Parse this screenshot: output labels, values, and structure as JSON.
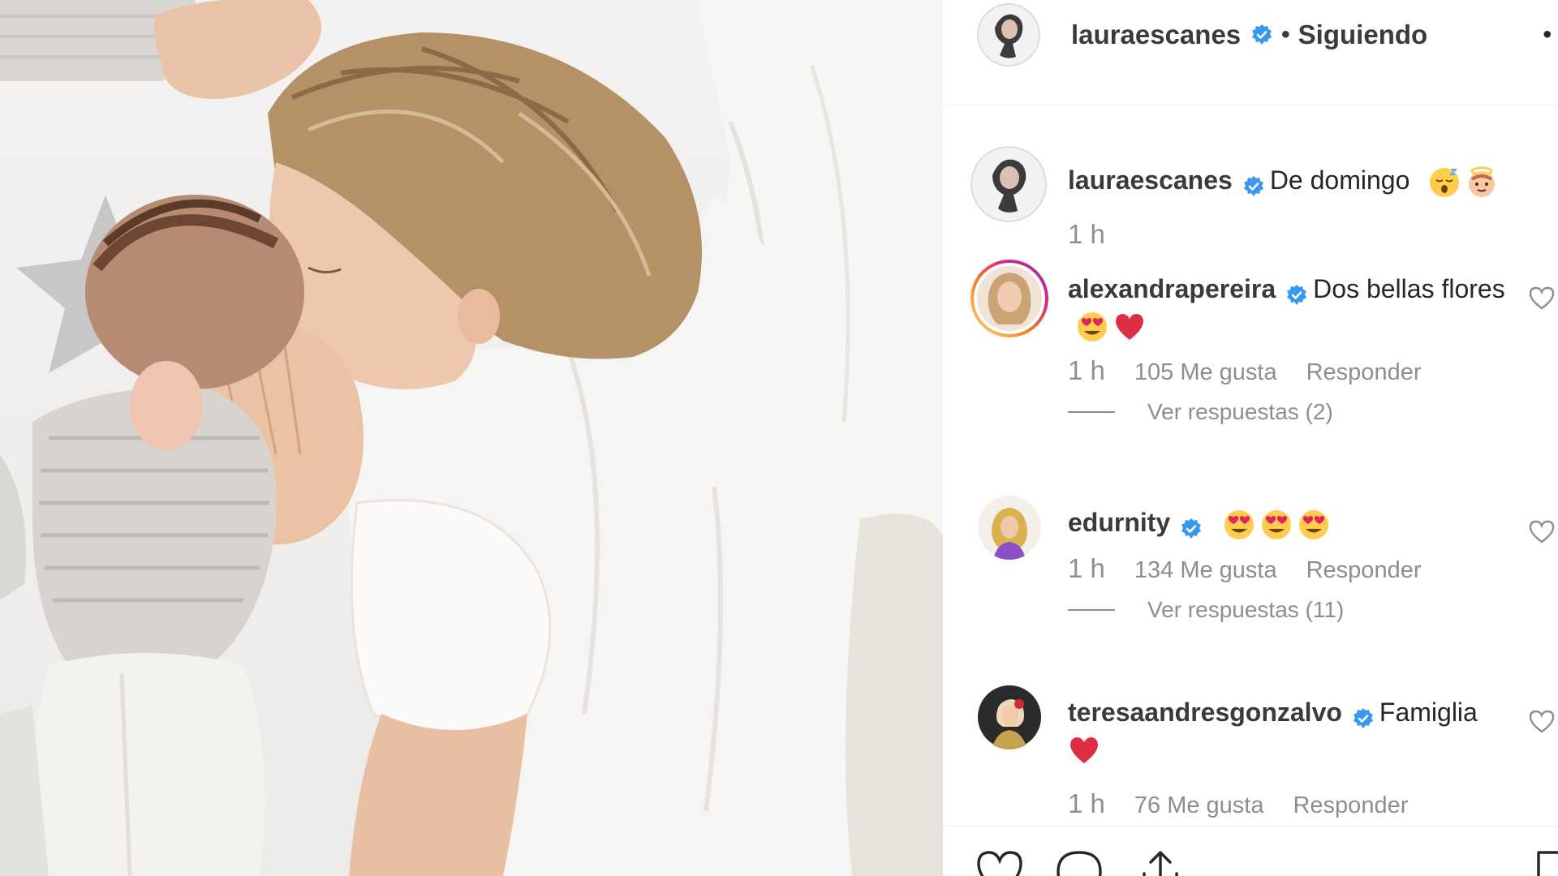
{
  "post": {
    "author": "lauraescanes",
    "follow_separator": "•",
    "follow_label": "Siguiendo",
    "more_label": "•",
    "caption": "De domingo",
    "caption_emojis": [
      "sleeping-face-emoji",
      "baby-angel-emoji"
    ],
    "caption_time": "1 h"
  },
  "comments": [
    {
      "user": "alexandrapereira",
      "text": "Dos bellas flores",
      "emojis": [
        "heart-eyes-emoji",
        "red-heart-emoji"
      ],
      "time": "1 h",
      "likes": "105 Me gusta",
      "reply_label": "Responder",
      "view_replies": "Ver respuestas (2)"
    },
    {
      "user": "edurnity",
      "text": "",
      "emojis": [
        "heart-eyes-emoji",
        "heart-eyes-emoji",
        "heart-eyes-emoji"
      ],
      "time": "1 h",
      "likes": "134 Me gusta",
      "reply_label": "Responder",
      "view_replies": "Ver respuestas (11)"
    },
    {
      "user": "teresaandresgonzalvo",
      "text": "Famiglia",
      "emojis": [
        "red-heart-emoji"
      ],
      "time": "1 h",
      "likes": "76 Me gusta",
      "reply_label": "Responder"
    }
  ],
  "icons": {
    "verified": "verified-badge-icon",
    "like": "heart-icon",
    "comment": "comment-bubble-icon",
    "share": "share-icon",
    "save": "bookmark-icon"
  },
  "colors": {
    "verified_blue": "#3897f0",
    "text": "#262626",
    "muted": "#8e8e8e",
    "divider": "#efefef",
    "emoji_red": "#e0245e",
    "emoji_yellow": "#ffcc4d"
  }
}
